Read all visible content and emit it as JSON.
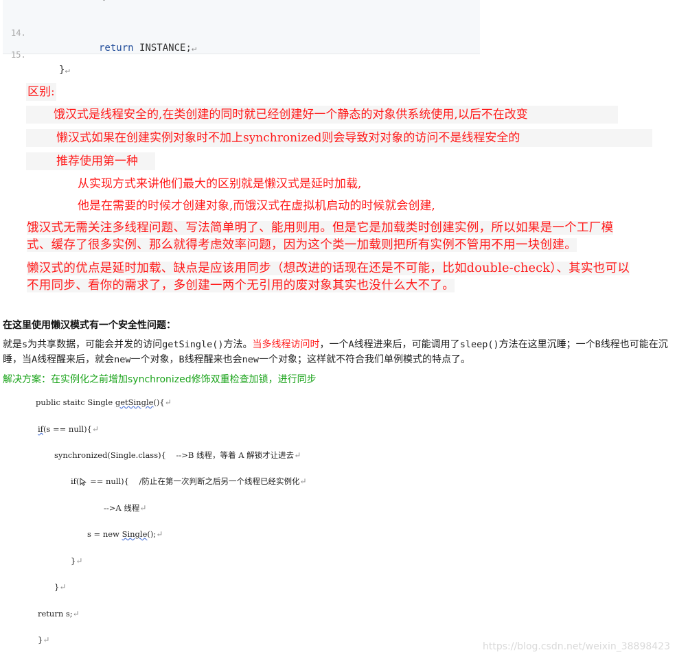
{
  "top_code": {
    "stub": "}",
    "lines": [
      {
        "num": "14.",
        "keyword": "return",
        "text": "INSTANCE;"
      },
      {
        "num": "15.",
        "keyword": "",
        "text": "}"
      }
    ],
    "pilcrow": "↵"
  },
  "notes": {
    "title": "区别:",
    "line1": "饿汉式是线程安全的,在类创建的同时就已经创建好一个静态的对象供系统使用,以后不在改变",
    "line2": "懒汉式如果在创建实例对象时不加上synchronized则会导致对对象的访问不是线程安全的",
    "line3": "推荐使用第一种",
    "line4": "从实现方式来讲他们最大的区别就是懒汉式是延时加载,",
    "line5": "他是在需要的时候才创建对象,而饿汉式在虚拟机启动的时候就会创建,",
    "para1_a": "饿汉式无需关注多线程问题、写法简单明了、能用则用。但是它是加载类时创建实例，所以如果是一个工厂模",
    "para1_b": "式、缓存了很多实例、那么就得考虑效率问题，因为这个类一加载则把所有实例不管用不用一块创建。",
    "para2_a": "懒汉式的优点是延时加载、缺点是应该用同步（想改进的话现在还是不可能，比如double-check）、其实也可以",
    "para2_b": "不用同步、看你的需求了，多创建一两个无引用的废对象其实也没什么大不了。"
  },
  "explain": {
    "title": "在这里使用懒汉模式有一个安全性问题：",
    "t1": "就是",
    "t2": "s",
    "t3": "为共享数据，可能会并发的访问",
    "t4": "getSingle()",
    "t5": "方法。",
    "t6_red": "当多线程访问时",
    "t7": "，一个",
    "t8": "A",
    "t9": "线程进来后，可能调用了",
    "t10": "sleep()",
    "t11": "方法在这里沉睡；一个",
    "t12": "B",
    "t13": "线程也可能在沉睡，当",
    "t14": "A",
    "t15": "线程醒来后，就会",
    "t16": "new",
    "t17": "一个对象，",
    "t18": "B",
    "t19": "线程醒来也会",
    "t20": "new",
    "t21": "一个对象；这样就不符合我们单例模式的特点了。",
    "solution": "解决方案：在实例化之前增加synchronized修饰双重检查加锁，进行同步"
  },
  "code2": {
    "l1a": "public staitc Single ",
    "l1b": "getSingle",
    "l1c": "(){",
    "l2a": "if",
    "l2b": "(s == null){",
    "l3a": "synchronized(Single.class){    ",
    "l3b": "-->B 线程，等着 A 解锁才让进去",
    "l4a": "if(",
    "l4b": " == null){    ",
    "l4c": "/防止在第一次判断之后另一个线程已经实例化",
    "l5": "-->A 线程",
    "l6a": "s = new ",
    "l6b": "Single",
    "l6c": "();",
    "l7": "}",
    "l8": "}",
    "l9": "return s;",
    "l10": "}",
    "pil": "↵"
  },
  "watermark": "https://blog.csdn.net/weixin_38898423"
}
